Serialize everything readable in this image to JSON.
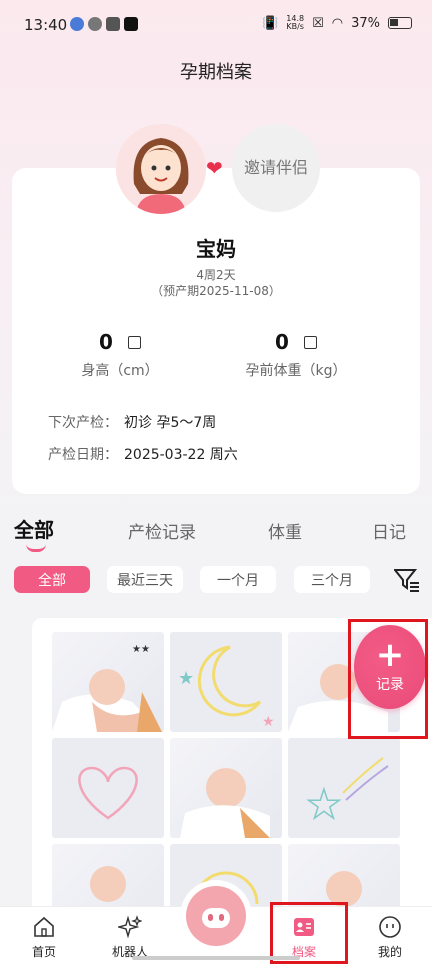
{
  "status_bar": {
    "time": "13:40",
    "speed_top": "14.8",
    "speed_bottom": "KB/s",
    "battery": "37%"
  },
  "header": {
    "title": "孕期档案"
  },
  "profile": {
    "invite_label": "邀请伴侣",
    "nickname": "宝妈",
    "week": "4周2天",
    "due_date": "（预产期2025-11-08）",
    "height_value": "0",
    "height_label": "身高（cm）",
    "weight_value": "0",
    "weight_label": "孕前体重（kg）",
    "next_checkup_label": "下次产检：",
    "next_checkup_value": "初诊 孕5～7周",
    "checkup_date_label": "产检日期：",
    "checkup_date_value": "2025-03-22 周六"
  },
  "tabs": [
    "全部",
    "产检记录",
    "体重",
    "日记"
  ],
  "filters": [
    "全部",
    "最近三天",
    "一个月",
    "三个月"
  ],
  "fab": {
    "plus": "+",
    "label": "记录"
  },
  "bottom_nav": {
    "home": "首页",
    "robot": "机器人",
    "archive": "档案",
    "mine": "我的"
  },
  "colors": {
    "accent": "#f05a83",
    "highlight_box": "#e0161e"
  }
}
